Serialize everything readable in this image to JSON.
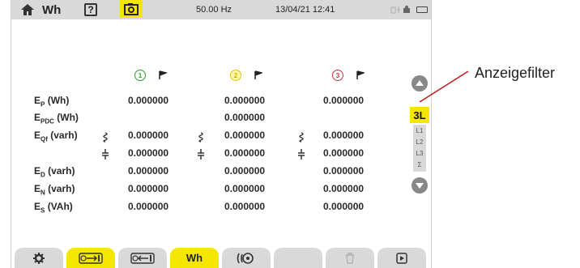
{
  "statusbar": {
    "title": "Wh",
    "help_label": "?",
    "frequency": "50.00 Hz",
    "datetime": "13/04/21 12:41"
  },
  "columns": [
    {
      "phase": "1",
      "color": "#2aa02a"
    },
    {
      "phase": "2",
      "color": "#e6c800"
    },
    {
      "phase": "3",
      "color": "#d0303a"
    }
  ],
  "rows": [
    {
      "label_main": "E",
      "label_sub": "P",
      "label_unit": " (Wh)",
      "values": [
        "0.000000",
        "0.000000",
        "0.000000"
      ],
      "q": ""
    },
    {
      "label_main": "E",
      "label_sub": "PDC",
      "label_unit": " (Wh)",
      "values": [
        "",
        "0.000000",
        ""
      ],
      "q": ""
    },
    {
      "label_main": "E",
      "label_sub": "Qf",
      "label_unit": " (varh)",
      "values": [
        "0.000000",
        "0.000000",
        "0.000000"
      ],
      "q": "inductive"
    },
    {
      "label_main": "",
      "label_sub": "",
      "label_unit": "",
      "values": [
        "0.000000",
        "0.000000",
        "0.000000"
      ],
      "q": "capacitive"
    },
    {
      "label_main": "E",
      "label_sub": "D",
      "label_unit": " (varh)",
      "values": [
        "0.000000",
        "0.000000",
        "0.000000"
      ],
      "q": ""
    },
    {
      "label_main": "E",
      "label_sub": "N",
      "label_unit": " (varh)",
      "values": [
        "0.000000",
        "0.000000",
        "0.000000"
      ],
      "q": ""
    },
    {
      "label_main": "E",
      "label_sub": "S",
      "label_unit": " (VAh)",
      "values": [
        "0.000000",
        "0.000000",
        "0.000000"
      ],
      "q": ""
    }
  ],
  "filter": {
    "active": "3L",
    "options": [
      "L1",
      "L2",
      "L3",
      "Σ"
    ]
  },
  "bottom_tabs": [
    {
      "icon": "gear-icon",
      "label": "",
      "active": false
    },
    {
      "icon": "energy-generated-icon",
      "label": "",
      "active": true
    },
    {
      "icon": "energy-received-icon",
      "label": "",
      "active": false
    },
    {
      "icon": "wh-icon",
      "label": "Wh",
      "active": true
    },
    {
      "icon": "dial-icon",
      "label": "",
      "active": false
    },
    {
      "icon": "blank-icon",
      "label": "",
      "active": false
    },
    {
      "icon": "trash-icon",
      "label": "",
      "active": false
    },
    {
      "icon": "play-icon",
      "label": "",
      "active": false
    }
  ],
  "callout": {
    "text": "Anzeigefilter"
  },
  "colors": {
    "accent": "#f5e600",
    "bar": "#d9d9d9"
  }
}
